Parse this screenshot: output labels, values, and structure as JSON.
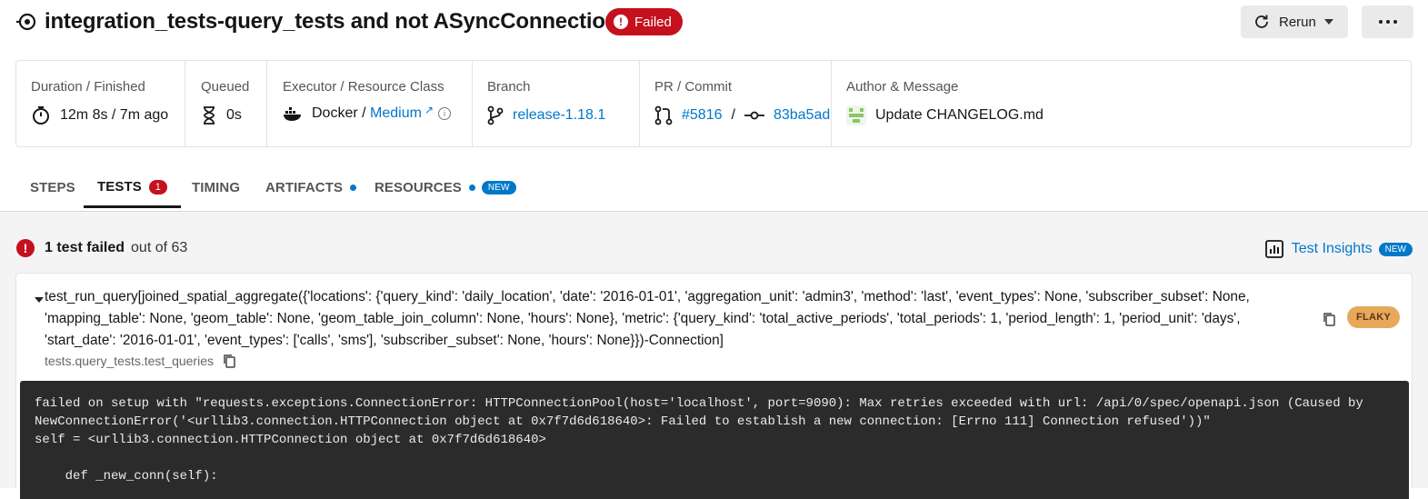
{
  "header": {
    "title": "integration_tests-query_tests and not ASyncConnection",
    "status": "Failed",
    "rerun_label": "Rerun"
  },
  "info": {
    "duration_label": "Duration / Finished",
    "duration_value": "12m 8s / 7m ago",
    "queued_label": "Queued",
    "queued_value": "0s",
    "executor_label": "Executor / Resource Class",
    "executor_value": "Docker",
    "resource_class": "Medium",
    "branch_label": "Branch",
    "branch_value": "release-1.18.1",
    "pr_label": "PR / Commit",
    "pr_value": "#5816",
    "commit_value": "83ba5ad",
    "author_label": "Author & Message",
    "author_message": "Update CHANGELOG.md"
  },
  "tabs": [
    {
      "label": "Steps"
    },
    {
      "label": "Tests",
      "count": "1"
    },
    {
      "label": "Timing"
    },
    {
      "label": "Artifacts"
    },
    {
      "label": "Resources",
      "badge": "NEW"
    }
  ],
  "summary": {
    "failed_text": "1 test failed",
    "out_of_text": "out of 63",
    "insights_label": "Test Insights",
    "insights_badge": "NEW"
  },
  "test": {
    "name": "test_run_query[joined_spatial_aggregate({'locations': {'query_kind': 'daily_location', 'date': '2016-01-01', 'aggregation_unit': 'admin3', 'method': 'last', 'event_types': None, 'subscriber_subset': None, 'mapping_table': None, 'geom_table': None, 'geom_table_join_column': None, 'hours': None}, 'metric': {'query_kind': 'total_active_periods', 'total_periods': 1, 'period_length': 1, 'period_unit': 'days', 'start_date': '2016-01-01', 'event_types': ['calls', 'sms'], 'subscriber_subset': None, 'hours': None}})-Connection]",
    "file": "tests.query_tests.test_queries",
    "badge": "FLAKY",
    "log": "failed on setup with \"requests.exceptions.ConnectionError: HTTPConnectionPool(host='localhost', port=9090): Max retries exceeded with url: /api/0/spec/openapi.json (Caused by\nNewConnectionError('<urllib3.connection.HTTPConnection object at 0x7f7d6d618640>: Failed to establish a new connection: [Errno 111] Connection refused'))\"\nself = <urllib3.connection.HTTPConnection object at 0x7f7d6d618640>\n\n    def _new_conn(self):"
  },
  "colors": {
    "failed_red": "#c5101d",
    "link_blue": "#0078ca",
    "flaky_orange": "#e8a85c",
    "log_bg": "#2b2b2b"
  }
}
